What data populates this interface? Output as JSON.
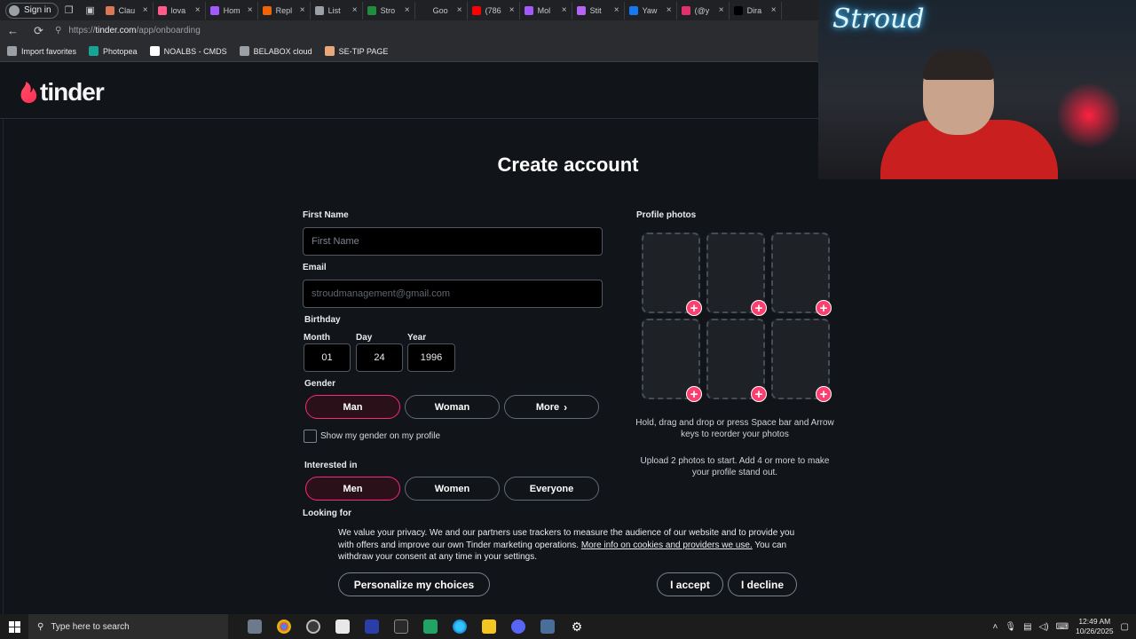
{
  "browser": {
    "signin_label": "Sign in",
    "tabs": [
      {
        "label": "Clau",
        "color": "#d97757"
      },
      {
        "label": "lova",
        "color": "#ff5c8a"
      },
      {
        "label": "Hom",
        "color": "#a259ff"
      },
      {
        "label": "Repl",
        "color": "#f26207"
      },
      {
        "label": "List",
        "color": "#9aa0a6"
      },
      {
        "label": "Stro",
        "color": "#1e8e3e"
      },
      {
        "label": "Goo",
        "color": "#202124"
      },
      {
        "label": "(786",
        "color": "#ff0000"
      },
      {
        "label": "Mol",
        "color": "#a259ff"
      },
      {
        "label": "Stit",
        "color": "#b565f5"
      },
      {
        "label": "Yaw",
        "color": "#1877f2"
      },
      {
        "label": "(@y",
        "color": "#e1306c"
      },
      {
        "label": "Dira",
        "color": "#000000"
      }
    ],
    "url_prefix": "https://",
    "url_host": "tinder.com",
    "url_path": "/app/onboarding",
    "bookmarks": [
      {
        "label": "Import favorites",
        "color": "#9aa0a6"
      },
      {
        "label": "Photopea",
        "color": "#18a497"
      },
      {
        "label": "NOALBS - CMDS",
        "color": "#ffffff"
      },
      {
        "label": "BELABOX cloud",
        "color": "#9aa0a6"
      },
      {
        "label": "SE-TIP PAGE",
        "color": "#e8a87c"
      }
    ]
  },
  "page": {
    "brand": "tinder",
    "title": "Create account",
    "first_name": {
      "label": "First Name",
      "placeholder": "First Name"
    },
    "email": {
      "label": "Email",
      "placeholder": "stroudmanagement@gmail.com"
    },
    "birthday": {
      "label": "Birthday",
      "month_label": "Month",
      "month_value": "01",
      "day_label": "Day",
      "day_value": "24",
      "year_label": "Year",
      "year_value": "1996"
    },
    "gender": {
      "label": "Gender",
      "options": [
        "Man",
        "Woman",
        "More"
      ],
      "selected": "Man",
      "show_on_profile": "Show my gender on my profile"
    },
    "interested_in": {
      "label": "Interested in",
      "options": [
        "Men",
        "Women",
        "Everyone"
      ],
      "selected": "Men"
    },
    "looking_for_label": "Looking for",
    "photos": {
      "label": "Profile photos",
      "hint1": "Hold, drag and drop or press Space bar and Arrow keys to reorder your photos",
      "hint2": "Upload 2 photos to start. Add 4 or more to make your profile stand out.",
      "plus": "+"
    },
    "accent_color": "#fd267d"
  },
  "cookie": {
    "text_before": "We value your privacy. We and our partners use trackers to measure the audience of our website and to provide you with offers and improve our own Tinder marketing operations. ",
    "link": "More info on cookies and providers we use.",
    "text_after": " You can withdraw your consent at any time in your settings.",
    "personalize": "Personalize my choices",
    "accept": "I accept",
    "decline": "I decline"
  },
  "webcam": {
    "neon_text": "Stroud"
  },
  "taskbar": {
    "search_placeholder": "Type here to search",
    "time": "12:49 AM",
    "date": "10/26/2025"
  }
}
